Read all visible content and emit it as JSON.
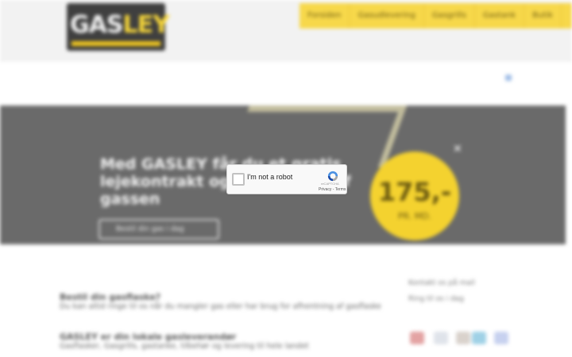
{
  "header": {
    "logo_main": "GAS",
    "logo_accent": "LEY",
    "nav": [
      "Forsiden",
      "Gasudlevering",
      "Gasgrills",
      "Gastank",
      "Butik"
    ]
  },
  "hero": {
    "title": "Med GASLEY får du et gratis lejekontrakt og afhentning af gassen",
    "button_label": "Bestil din gas i dag",
    "price": "175,-",
    "price_unit": "PR. MD.",
    "close_symbol": "✕"
  },
  "content": {
    "heading1": "Bestil din gasflaske?",
    "text1": "Du kan altid ringe til os når du mangler gas eller har brug for afhentning af gasflaske",
    "heading2": "GASLEY er din lokale gasleverandør",
    "text2": "Gasflasker, Gasgrills, gastanke, tilbehør og levering til hele landet"
  },
  "sidebar": {
    "line1": "Kontakt os på mail",
    "line2": "Ring til os i dag"
  },
  "recaptcha": {
    "label": "I'm not a robot",
    "brand": "reCAPTCHA",
    "privacy": "Privacy",
    "separator": " - ",
    "terms": "Terms",
    "checked": false
  },
  "colors": {
    "accent_yellow": "#f4d22f",
    "hero_gray": "#6a6a6a"
  }
}
